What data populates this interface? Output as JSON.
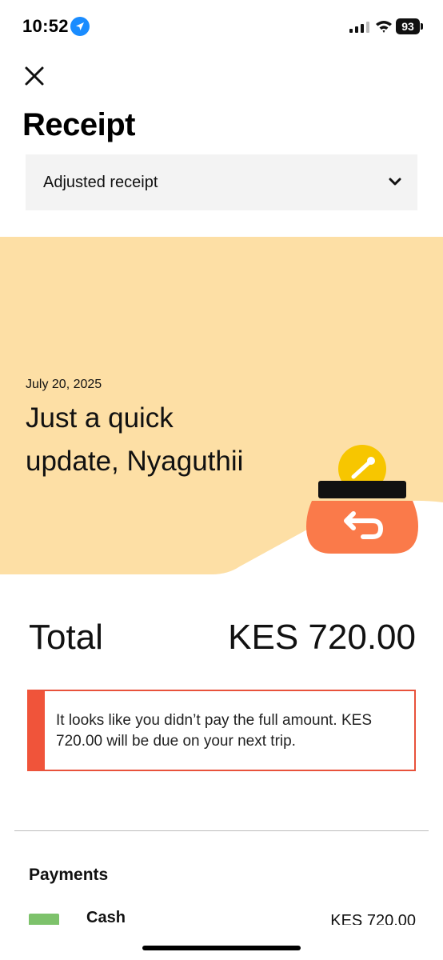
{
  "status_bar": {
    "time": "10:52",
    "battery": "93"
  },
  "header": {
    "title": "Receipt"
  },
  "receipt_select": {
    "value": "Adjusted receipt"
  },
  "hero": {
    "date": "July 20, 2025",
    "greeting": "Just a quick update, Nyaguthii"
  },
  "total": {
    "label": "Total",
    "amount": "KES 720.00"
  },
  "notice": {
    "text": "It looks like you didn’t pay the full amount. KES 720.00 will be due on your next trip."
  },
  "payments": {
    "heading": "Payments",
    "items": [
      {
        "method": "Cash",
        "amount": "KES 720.00"
      }
    ]
  },
  "colors": {
    "hero_bg": "#fddfa5",
    "alert": "#f0543a",
    "coin": "#f7c600",
    "wallet": "#fa7a4a"
  }
}
